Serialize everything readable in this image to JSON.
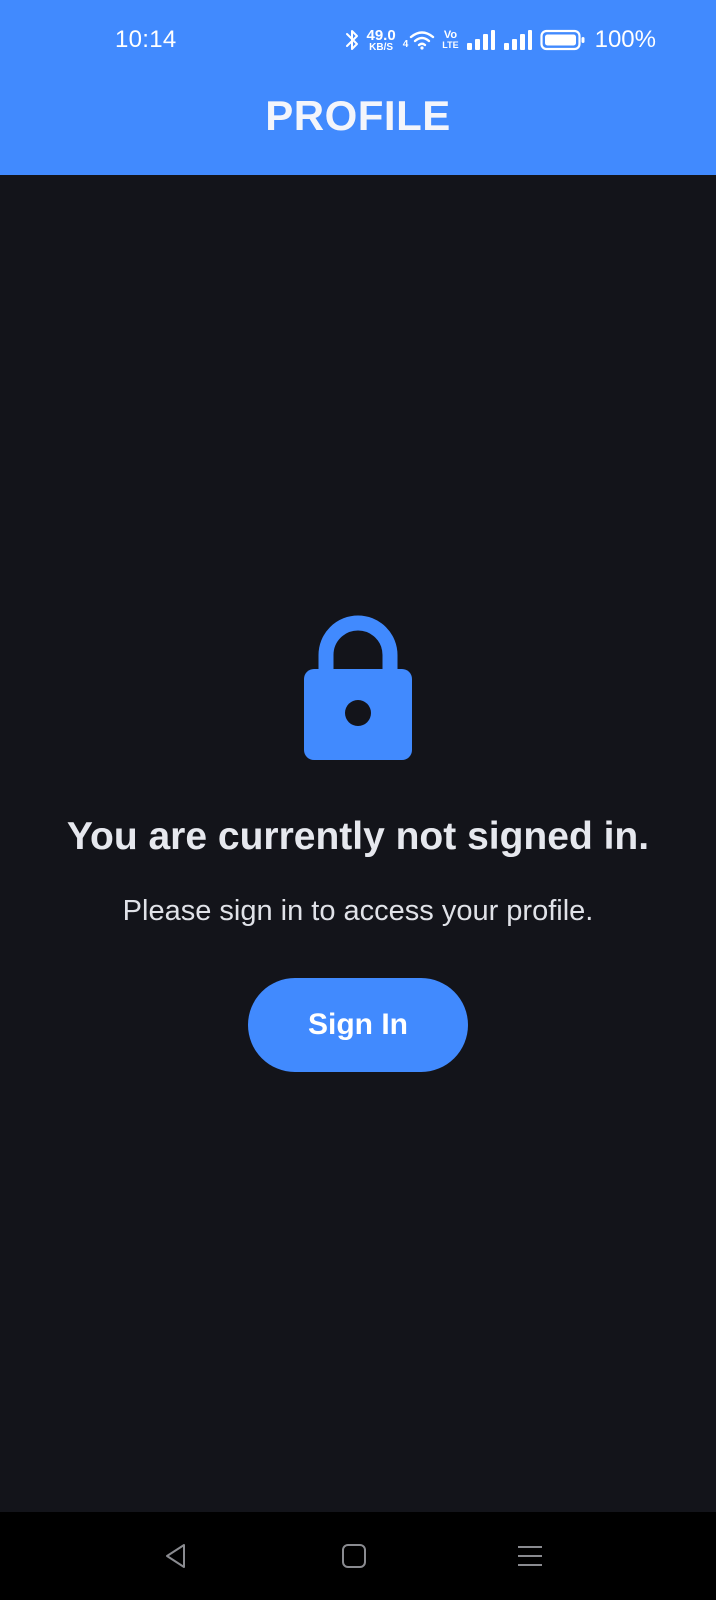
{
  "status_bar": {
    "time": "10:14",
    "net_speed_value": "49.0",
    "net_speed_unit": "KB/S",
    "wifi_badge": "4",
    "volte_top": "Vo",
    "volte_bottom": "LTE",
    "battery_percent": "100%",
    "icons": [
      "bluetooth-icon",
      "wifi-icon",
      "volte-icon",
      "signal-icon",
      "signal-icon",
      "battery-icon"
    ]
  },
  "header": {
    "title": "PROFILE"
  },
  "main": {
    "icon": "lock-icon",
    "headline": "You are currently not signed in.",
    "subtext": "Please sign in to access your profile.",
    "sign_in_label": "Sign In"
  },
  "navigation_bar": {
    "icons": [
      "back-icon",
      "home-icon",
      "recents-icon"
    ]
  },
  "colors": {
    "accent": "#418afe",
    "background": "#13141a",
    "nav_background": "#000000",
    "text_primary": "#e6e8ee"
  }
}
